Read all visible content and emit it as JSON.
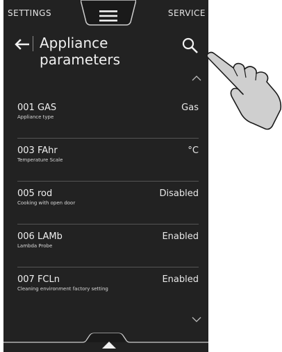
{
  "topbar": {
    "left_tab": "SETTINGS",
    "right_tab": "SERVICE",
    "menu_icon": "hamburger-menu-icon"
  },
  "header": {
    "title_line1": "Appliance",
    "title_line2": "parameters",
    "back_icon": "arrow-left-icon",
    "search_icon": "search-icon"
  },
  "params": [
    {
      "code": "001 GAS",
      "desc": "Appliance type",
      "value": "Gas"
    },
    {
      "code": "003 FAhr",
      "desc": "Temperature Scale",
      "value": "°C"
    },
    {
      "code": "005 rod",
      "desc": "Cooking with open door",
      "value": "Disabled"
    },
    {
      "code": "006 LAMb",
      "desc": "Lambda Probe",
      "value": "Enabled"
    },
    {
      "code": "007 FCLn",
      "desc": "Cleaning environment factory setting",
      "value": "Enabled"
    }
  ],
  "colors": {
    "background": "#222222",
    "text": "#f0f0f0",
    "divider": "#555555"
  }
}
